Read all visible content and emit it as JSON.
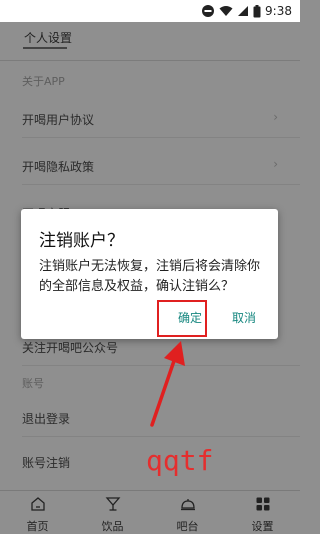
{
  "status_bar": {
    "time": "9:38"
  },
  "page": {
    "title": "个人设置"
  },
  "sections": {
    "about": {
      "label": "关于APP"
    },
    "account": {
      "label": "账号"
    }
  },
  "rows": {
    "user_agreement": "开喝用户协议",
    "privacy_policy": "开喝隐私政策",
    "obscured_row": "开喝客服",
    "obscured_row_2": "关注开喝吧公众号",
    "logout": "退出登录",
    "delete_account": "账号注销",
    "chevron": "›"
  },
  "dialog": {
    "title": "注销账户？",
    "message": "注销账户无法恢复，注销后将会清除你的全部信息及权益，确认注销么？",
    "confirm": "确定",
    "cancel": "取消"
  },
  "tabs": [
    {
      "label": "首页",
      "icon": "home-icon"
    },
    {
      "label": "饮品",
      "icon": "cocktail-icon"
    },
    {
      "label": "吧台",
      "icon": "service-bell-icon"
    },
    {
      "label": "设置",
      "icon": "grid-settings-icon"
    }
  ],
  "annotation": {
    "text": "qqtf"
  },
  "colors": {
    "accent": "#16877f",
    "annotation": "#e02020"
  }
}
